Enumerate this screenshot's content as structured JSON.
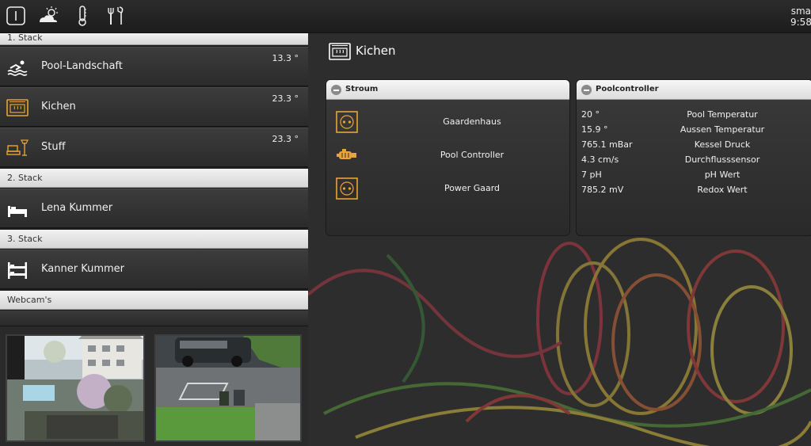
{
  "topbar": {
    "icons": [
      "power-icon",
      "weather-icon",
      "thermometer-icon",
      "tools-icon"
    ],
    "brand_line1": "sma",
    "brand_line2": "9:58,"
  },
  "sidebar": {
    "stack1_label": "1. Stack",
    "stack2_label": "2. Stack",
    "stack3_label": "3. Stack",
    "webcams_label": "Webcam's",
    "rooms": [
      {
        "label": "Pool-Landschaft",
        "temp": "13.3 °",
        "icon": "swimmer-icon"
      },
      {
        "label": "Kichen",
        "temp": "23.3 °",
        "icon": "oven-icon"
      },
      {
        "label": "Stuff",
        "temp": "23.3 °",
        "icon": "living-room-icon"
      },
      {
        "label": "Lena Kummer",
        "temp": "",
        "icon": "bed-icon"
      },
      {
        "label": "Kanner Kummer",
        "temp": "",
        "icon": "bunk-bed-icon"
      }
    ]
  },
  "main": {
    "room_title": "Kichen",
    "stroum": {
      "title": "Stroum",
      "items": [
        {
          "label": "Gaardenhaus",
          "icon": "socket-icon"
        },
        {
          "label": "Pool Controller",
          "icon": "pump-icon"
        },
        {
          "label": "Power Gaard",
          "icon": "socket-icon"
        }
      ]
    },
    "poolcontroller": {
      "title": "Poolcontroller",
      "rows": [
        {
          "value": "20 °",
          "label": "Pool Temperatur"
        },
        {
          "value": "15.9 °",
          "label": "Aussen Temperatur"
        },
        {
          "value": "765.1 mBar",
          "label": "Kessel Druck"
        },
        {
          "value": "4.3 cm/s",
          "label": "Durchflusssensor"
        },
        {
          "value": "7 pH",
          "label": "pH Wert"
        },
        {
          "value": "785.2 mV",
          "label": "Redox Wert"
        }
      ]
    }
  },
  "colors": {
    "accent_orange": "#e8a33a",
    "header_light": "#e6e6e6"
  }
}
